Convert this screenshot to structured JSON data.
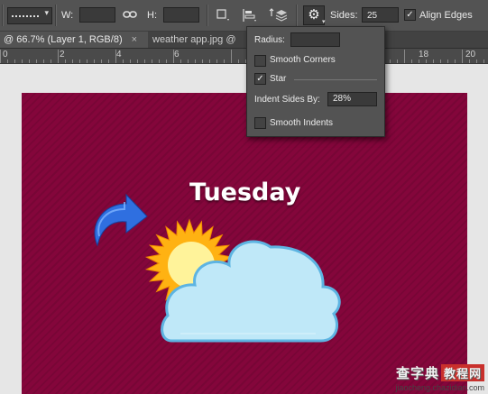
{
  "options_bar": {
    "w_label": "W:",
    "h_label": "H:",
    "sides_label": "Sides:",
    "sides_value": "25",
    "align_edges_label": "Align Edges",
    "align_edges_checked": true
  },
  "tabs": [
    {
      "label": "@ 66.7% (Layer 1, RGB/8)",
      "close": "×",
      "active": true
    },
    {
      "label": "weather app.jpg @",
      "active": false
    }
  ],
  "ruler": {
    "labels": [
      "0",
      "2",
      "4",
      "6",
      "18",
      "20"
    ]
  },
  "polygon_options": {
    "radius_label": "Radius:",
    "radius_value": "",
    "smooth_corners_label": "Smooth Corners",
    "smooth_corners_checked": false,
    "star_label": "Star",
    "star_checked": true,
    "indent_label": "Indent Sides By:",
    "indent_value": "28%",
    "smooth_indents_label": "Smooth Indents",
    "smooth_indents_checked": false
  },
  "canvas": {
    "title": "Tuesday",
    "background_color": "#84063b"
  },
  "watermark": {
    "line1": "查字典",
    "line1_box": "教程网",
    "line2": "jiaocheng.chazidian.com"
  },
  "icons": [
    "link-icon",
    "square-icon",
    "align-icon",
    "arrange-icon",
    "gear-icon",
    "check-icon",
    "curved-arrow-icon",
    "sun-icon",
    "cloud-icon"
  ]
}
